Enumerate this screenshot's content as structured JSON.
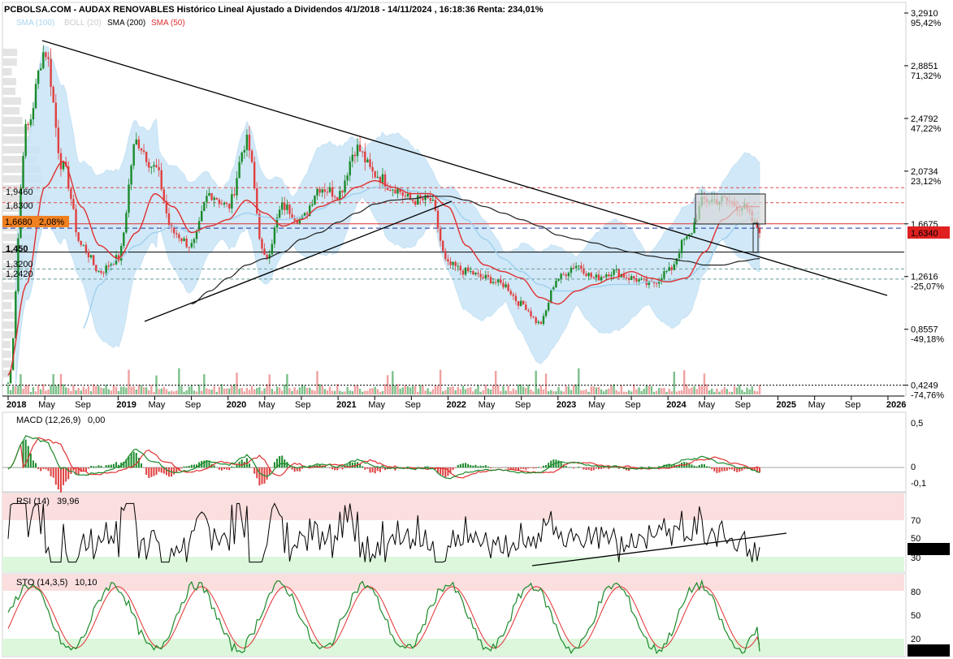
{
  "header": {
    "title": "PCBOLSA.COM - AUDAX RENOVABLES Histórico Lineal Ajustado a Dividendos 4/1/2018 - 14/11/2024 , 16:18:36 Renta: 234,01%"
  },
  "legend": [
    {
      "label": "SMA (100)",
      "color": "#a8d4f0"
    },
    {
      "label": "BOLL (20)",
      "color": "#cccccc"
    },
    {
      "label": "SMA (200)",
      "color": "#000000"
    },
    {
      "label": "SMA (50)",
      "color": "#e03030"
    }
  ],
  "colors": {
    "bull": "#1a8a2a",
    "bear": "#e04040",
    "band": "#c8e4f6",
    "sma200": "#222222",
    "sma50": "#e03030",
    "sma100": "#9fd0f0",
    "green_text": "#20a050",
    "red_text": "#e03030",
    "rsi_upper_zone": "#fbdede",
    "rsi_lower_zone": "#dcf7dc"
  },
  "price_axis": {
    "labels": [
      {
        "price": "3,2910",
        "pct": "95,42%",
        "pct_color": "green"
      },
      {
        "price": "2,8851",
        "pct": "71,32%",
        "pct_color": "green"
      },
      {
        "price": "2,4792",
        "pct": "47,22%",
        "pct_color": "green"
      },
      {
        "price": "2,0734",
        "pct": "23,12%",
        "pct_color": "green"
      },
      {
        "price": "1,6675",
        "pct": "",
        "pct_color": ""
      },
      {
        "price": "1,2616",
        "pct": "-25,07%",
        "pct_color": "red"
      },
      {
        "price": "0,8557",
        "pct": "-49,18%",
        "pct_color": "red"
      },
      {
        "price": "0,4249",
        "pct": "-74,76%",
        "pct_color": "red"
      }
    ],
    "current_price_tag": "1,6340"
  },
  "level_labels": {
    "l1946": "1,9460",
    "l1830": "1,8300",
    "l1668": "1,6680",
    "l1668_pct": "2,08%",
    "l1450": "1,450",
    "l1320": "1,3200",
    "l1242": "1,2420"
  },
  "time_axis": {
    "labels": [
      "2018",
      "May",
      "Sep",
      "2019",
      "May",
      "Sep",
      "2020",
      "May",
      "Sep",
      "2021",
      "May",
      "Sep",
      "2022",
      "May",
      "Sep",
      "2023",
      "May",
      "Sep",
      "2024",
      "May",
      "Sep",
      "2025",
      "May",
      "Sep",
      "2026"
    ],
    "bold": [
      "2018",
      "2019",
      "2020",
      "2021",
      "2022",
      "2023",
      "2024",
      "2025",
      "2026"
    ]
  },
  "macd": {
    "title": "MACD (12,26,9)",
    "value": "0,00",
    "axis": [
      {
        "label": "0,5",
        "color": "red"
      },
      {
        "label": "0",
        "color": "black"
      },
      {
        "label": "-0,1",
        "color": "green"
      }
    ]
  },
  "rsi": {
    "title": "RSI (14)",
    "value": "39,96",
    "axis": [
      {
        "label": "70",
        "color": "red"
      },
      {
        "label": "50",
        "color": "black"
      },
      {
        "label": "30",
        "color": "green"
      }
    ],
    "current_tag": "39,961"
  },
  "sto": {
    "title": "STO (14,3,5)",
    "value": "10,10",
    "axis": [
      {
        "label": "80",
        "color": "red"
      },
      {
        "label": "50",
        "color": "black"
      },
      {
        "label": "20",
        "color": "green"
      }
    ],
    "current_tag": "10,104"
  },
  "chart_data": {
    "type": "line",
    "title": "PCBOLSA.COM - AUDAX RENOVABLES Histórico Lineal Ajustado a Dividendos 4/1/2018 - 14/11/2024 , 16:18:36 Renta: 234,01%",
    "x": [
      "2018-01",
      "2018-03",
      "2018-05",
      "2018-07",
      "2018-09",
      "2018-11",
      "2019-01",
      "2019-03",
      "2019-05",
      "2019-07",
      "2019-09",
      "2019-11",
      "2020-01",
      "2020-03",
      "2020-05",
      "2020-07",
      "2020-09",
      "2020-11",
      "2021-01",
      "2021-03",
      "2021-05",
      "2021-07",
      "2021-09",
      "2021-11",
      "2022-01",
      "2022-03",
      "2022-05",
      "2022-07",
      "2022-09",
      "2022-11",
      "2023-01",
      "2023-03",
      "2023-05",
      "2023-07",
      "2023-09",
      "2023-11",
      "2024-01",
      "2024-03",
      "2024-05",
      "2024-07",
      "2024-09",
      "2024-11"
    ],
    "series": [
      {
        "name": "AUDAX RENOVABLES",
        "values": [
          0.44,
          2.4,
          3.0,
          2.1,
          1.5,
          1.3,
          1.4,
          2.3,
          2.1,
          1.6,
          1.5,
          1.9,
          1.8,
          2.3,
          1.4,
          1.8,
          1.7,
          1.95,
          1.9,
          2.25,
          2.05,
          1.95,
          1.85,
          1.85,
          1.35,
          1.3,
          1.25,
          1.2,
          1.05,
          0.9,
          1.25,
          1.35,
          1.25,
          1.3,
          1.25,
          1.2,
          1.3,
          1.55,
          1.85,
          1.85,
          1.8,
          1.63
        ]
      },
      {
        "name": "SMA (50)",
        "values": [
          0.5,
          1.2,
          1.95,
          2.15,
          1.8,
          1.5,
          1.4,
          1.6,
          1.9,
          1.8,
          1.6,
          1.65,
          1.7,
          1.85,
          1.75,
          1.65,
          1.7,
          1.8,
          1.85,
          1.95,
          2.0,
          1.95,
          1.9,
          1.9,
          1.8,
          1.5,
          1.35,
          1.3,
          1.25,
          1.1,
          1.05,
          1.15,
          1.2,
          1.25,
          1.3,
          1.25,
          1.22,
          1.25,
          1.45,
          1.7,
          1.8,
          1.8
        ]
      },
      {
        "name": "SMA (200)",
        "values": [
          null,
          null,
          null,
          null,
          null,
          null,
          null,
          null,
          null,
          null,
          1.05,
          1.15,
          1.25,
          1.35,
          1.4,
          1.45,
          1.55,
          1.6,
          1.68,
          1.75,
          1.82,
          1.85,
          1.86,
          1.88,
          1.88,
          1.85,
          1.8,
          1.75,
          1.7,
          1.65,
          1.58,
          1.55,
          1.52,
          1.48,
          1.45,
          1.42,
          1.4,
          1.38,
          1.35,
          1.35,
          1.38,
          1.4
        ]
      },
      {
        "name": "SMA (100)",
        "values": [
          null,
          null,
          null,
          null,
          0.85,
          1.2,
          1.4,
          1.5,
          1.6,
          1.65,
          1.6,
          1.65,
          1.7,
          1.75,
          1.72,
          1.7,
          1.72,
          1.78,
          1.85,
          1.9,
          1.95,
          1.95,
          1.92,
          1.9,
          1.85,
          1.7,
          1.55,
          1.4,
          1.3,
          1.2,
          1.15,
          1.15,
          1.18,
          1.2,
          1.2,
          1.22,
          1.23,
          1.25,
          1.35,
          1.55,
          1.68,
          1.75
        ]
      }
    ],
    "ylim": [
      0.36,
      3.36
    ],
    "horizontal_levels": [
      1.946,
      1.83,
      1.668,
      1.634,
      1.45,
      1.32,
      1.242,
      0.4249
    ],
    "trendlines": [
      {
        "from": [
          "2018-04",
          3.27
        ],
        "to": [
          "2025-01",
          1.21
        ]
      },
      {
        "from": [
          "2018-12",
          0.8
        ],
        "to": [
          "2022-02",
          1.77
        ]
      }
    ],
    "macd": {
      "macd": 0.0,
      "ylim": [
        -0.1,
        0.5
      ]
    },
    "rsi": {
      "last": 39.96,
      "levels": [
        70,
        50,
        30
      ]
    },
    "stochastic": {
      "last": 10.1,
      "levels": [
        80,
        50,
        20
      ]
    }
  }
}
